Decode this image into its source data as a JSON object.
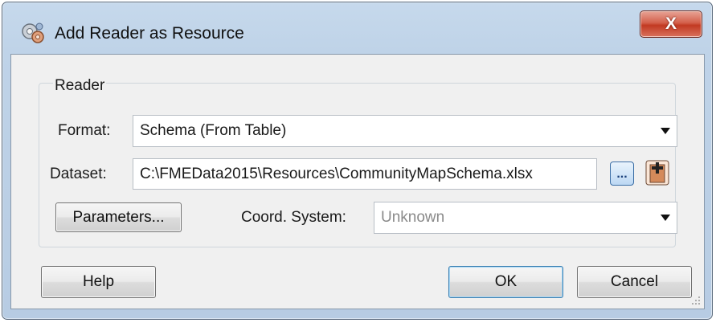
{
  "window": {
    "title": "Add Reader as Resource",
    "close_label": "X",
    "app_icon": "fme-transformer-gears-icon"
  },
  "reader_group": {
    "title": "Reader",
    "format": {
      "label": "Format:",
      "value": "Schema (From Table)"
    },
    "dataset": {
      "label": "Dataset:",
      "value": "C:\\FMEData2015\\Resources\\CommunityMapSchema.xlsx",
      "browse_label": "..."
    },
    "parameters_button": "Parameters...",
    "coord_system": {
      "label": "Coord. System:",
      "value": "Unknown"
    }
  },
  "buttons": {
    "help": "Help",
    "ok": "OK",
    "cancel": "Cancel"
  },
  "colors": {
    "title_bar": "#bfd3e8",
    "close_red": "#c23a22",
    "client_bg": "#f0f0f0",
    "ok_border": "#3c7fb1"
  }
}
